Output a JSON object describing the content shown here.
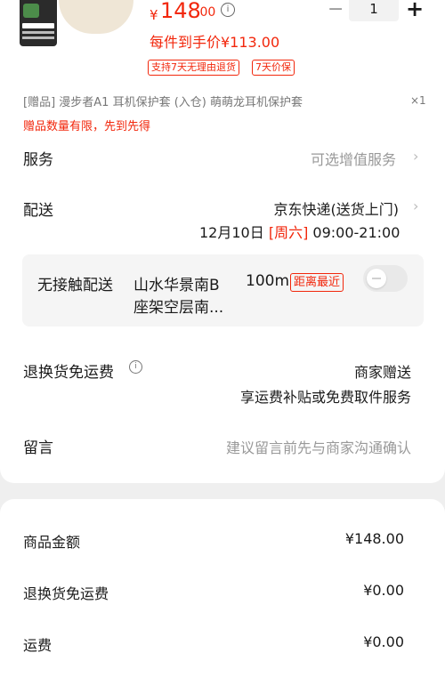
{
  "product": {
    "price_symbol": "¥",
    "price_int": "148",
    "price_dec": ".00",
    "info_glyph": "i",
    "quantity": "1",
    "minus_glyph": "−",
    "plus_glyph": "+",
    "each_price": "每件到手价¥113.00",
    "tags": [
      "支持7天无理由退货",
      "7天价保"
    ]
  },
  "gift": {
    "line": "[赠品]  漫步者A1 耳机保护套 (入仓) 萌萌龙耳机保护套",
    "qty": "×1",
    "warning": "赠品数量有限，先到先得"
  },
  "service": {
    "label": "服务",
    "value": "可选增值服务"
  },
  "delivery": {
    "label": "配送",
    "method": "京东快递(送货上门)",
    "date": "12月10日",
    "weekday": "[周六]",
    "time": "09:00-21:00"
  },
  "contactless": {
    "label": "无接触配送",
    "address_line1": "山水华景南B",
    "address_line2": "座架空层南...",
    "distance": "100m",
    "badge": "距离最近"
  },
  "return_shipping": {
    "label": "退换货免运费",
    "info_glyph": "i",
    "value": "商家赠送",
    "desc": "享运费补贴或免费取件服务"
  },
  "message": {
    "label": "留言",
    "placeholder": "建议留言前先与商家沟通确认"
  },
  "summary": [
    {
      "label": "商品金额",
      "value": "¥148.00"
    },
    {
      "label": "退换货免运费",
      "value": "¥0.00"
    },
    {
      "label": "运费",
      "value": "¥0.00"
    }
  ],
  "icons": {
    "chevron": "›",
    "product_thumb": "product-thumbnail",
    "earbud": "earbud-case-image"
  },
  "colors": {
    "accent": "#f2270c",
    "background": "#efefef",
    "card": "#ffffff"
  }
}
